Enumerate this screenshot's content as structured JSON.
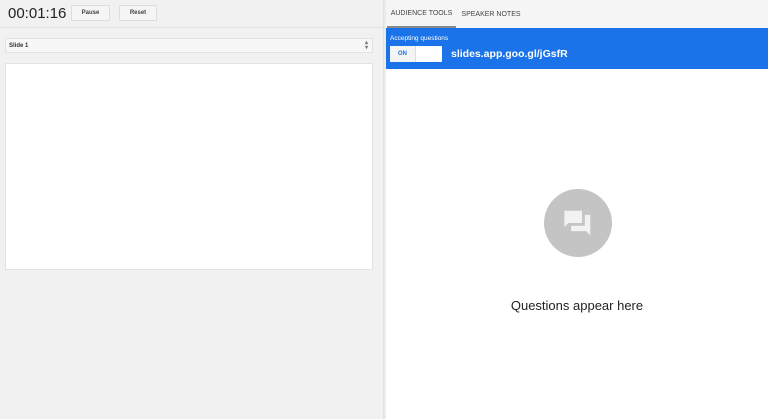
{
  "timer": {
    "value": "00:01:16",
    "pause_label": "Pause",
    "reset_label": "Reset"
  },
  "slide_select": {
    "value": "Slide 1"
  },
  "tabs": [
    {
      "label": "AUDIENCE TOOLS",
      "active": true
    },
    {
      "label": "SPEAKER NOTES",
      "active": false
    }
  ],
  "audience": {
    "accepting_label": "Accepting questions",
    "toggle_label": "ON",
    "url": "slides.app.goo.gl/jGsfR",
    "empty_text": "Questions appear here",
    "icon": "question-answer-icon"
  },
  "colors": {
    "accent": "#1a73e8"
  }
}
